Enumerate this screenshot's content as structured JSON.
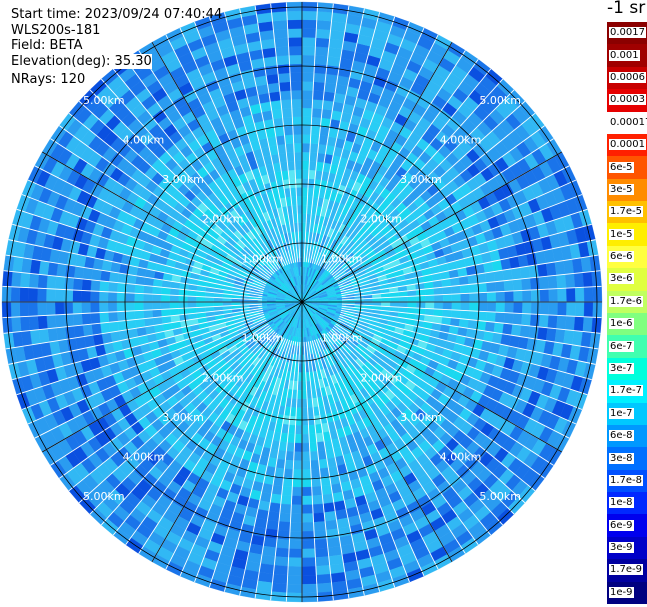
{
  "info": {
    "start_time": "Start time: 2023/09/24 07:40:44",
    "instrument": "WLS200s-181",
    "field": "Field: BETA",
    "elevation": "Elevation(deg): 35.30",
    "nrays": "NRays: 120"
  },
  "range_labels": [
    "1.00km",
    "2.00km",
    "3.00km",
    "4.00km",
    "5.00km"
  ],
  "nrays": 120,
  "legend": {
    "unit_title": "-1 sr",
    "labels": [
      "0.0017",
      "0.001",
      "0.0006",
      "0.0003",
      "0.00017",
      "0.0001",
      "6e-5",
      "3e-5",
      "1.7e-5",
      "1e-5",
      "6e-6",
      "3e-6",
      "1.7e-6",
      "1e-6",
      "6e-7",
      "3e-7",
      "1.7e-7",
      "1e-7",
      "6e-8",
      "3e-8",
      "1.7e-8",
      "1e-8",
      "6e-9",
      "3e-9",
      "1.7e-9",
      "1e-9"
    ],
    "colors": [
      "#8b0000",
      "#a00000",
      "#c80000",
      "#e60000",
      "#ffffff",
      "#ff2000",
      "#ff5500",
      "#ff8c00",
      "#ffc000",
      "#ffee00",
      "#ffff40",
      "#e0ff40",
      "#c0ff60",
      "#80ff80",
      "#40ffb0",
      "#00ffdc",
      "#00f0ff",
      "#00c8ff",
      "#0098ff",
      "#0070ff",
      "#0050ff",
      "#0028ff",
      "#0000ee",
      "#0000c8",
      "#0000a0",
      "#000080"
    ]
  }
}
